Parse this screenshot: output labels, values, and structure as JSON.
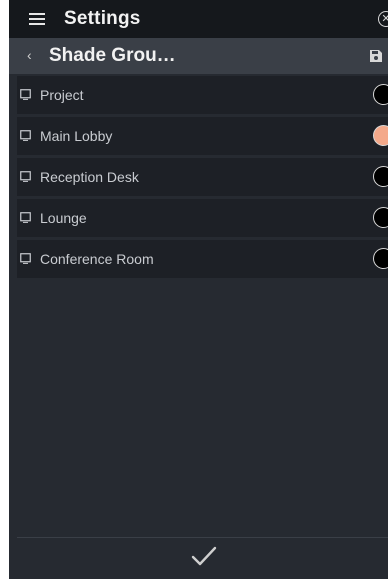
{
  "header": {
    "title": "Settings",
    "menu_icon": "hamburger-menu-icon",
    "close_icon": "circle-x-icon",
    "close_glyph": "✕"
  },
  "subheader": {
    "title": "Shade Grou…",
    "back_icon": "chevron-left-icon",
    "back_glyph": "‹",
    "save_icon": "save-floppy-icon"
  },
  "list": {
    "items": [
      {
        "label": "Project",
        "selected": false
      },
      {
        "label": "Main Lobby",
        "selected": true
      },
      {
        "label": "Reception Desk",
        "selected": false
      },
      {
        "label": "Lounge",
        "selected": false
      },
      {
        "label": "Conference Room",
        "selected": false
      }
    ],
    "item_icon": "shade-icon"
  },
  "footer": {
    "confirm_icon": "checkmark-icon"
  },
  "colors": {
    "background": "#262a31",
    "topbar": "#15181c",
    "subbar": "#3a3f47",
    "row": "#1d2026",
    "selected_accent": "#f4a98a",
    "text": "#c9ccd1"
  }
}
